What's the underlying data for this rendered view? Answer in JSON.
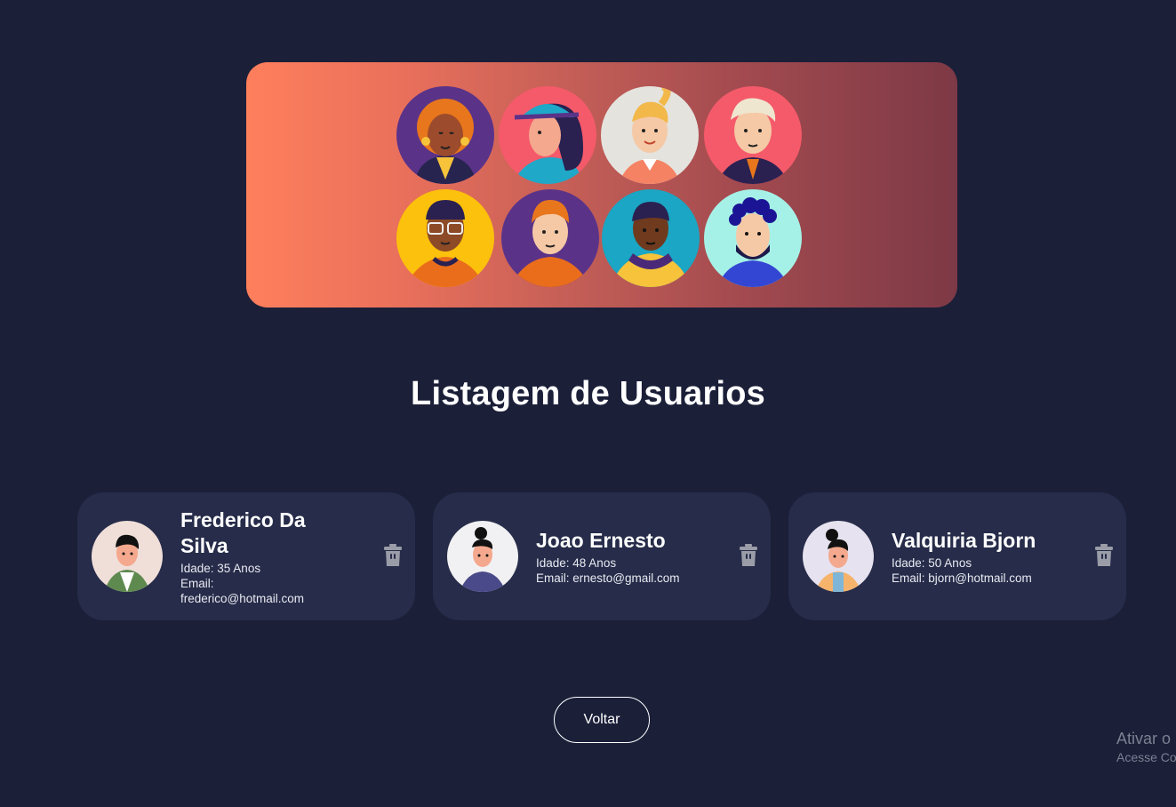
{
  "page": {
    "title": "Listagem de Usuarios",
    "back_button": "Voltar"
  },
  "hero": {
    "avatars": [
      "woman-curly-hair",
      "woman-cap",
      "woman-ponytail",
      "man-white-hair",
      "man-glasses",
      "man-freckles",
      "man-hoodie",
      "man-beard"
    ]
  },
  "users": [
    {
      "name": "Frederico Da Silva",
      "age": "Idade: 35 Anos",
      "email_label": "Email:",
      "email": "frederico@hotmail.com"
    },
    {
      "name": "Joao Ernesto",
      "age": "Idade: 48 Anos",
      "email_label": "Email:",
      "email": "ernesto@gmail.com"
    },
    {
      "name": "Valquiria Bjorn",
      "age": "Idade: 50 Anos",
      "email_label": "Email:",
      "email": "bjorn@hotmail.com"
    }
  ],
  "watermark": {
    "line1": "Ativar o",
    "line2": "Acesse Co"
  },
  "colors": {
    "background": "#1b1f38",
    "card": "#262c49",
    "hero_start": "#fe7f5c",
    "hero_end": "#7d3946",
    "trash_icon": "#9a9ca8"
  }
}
